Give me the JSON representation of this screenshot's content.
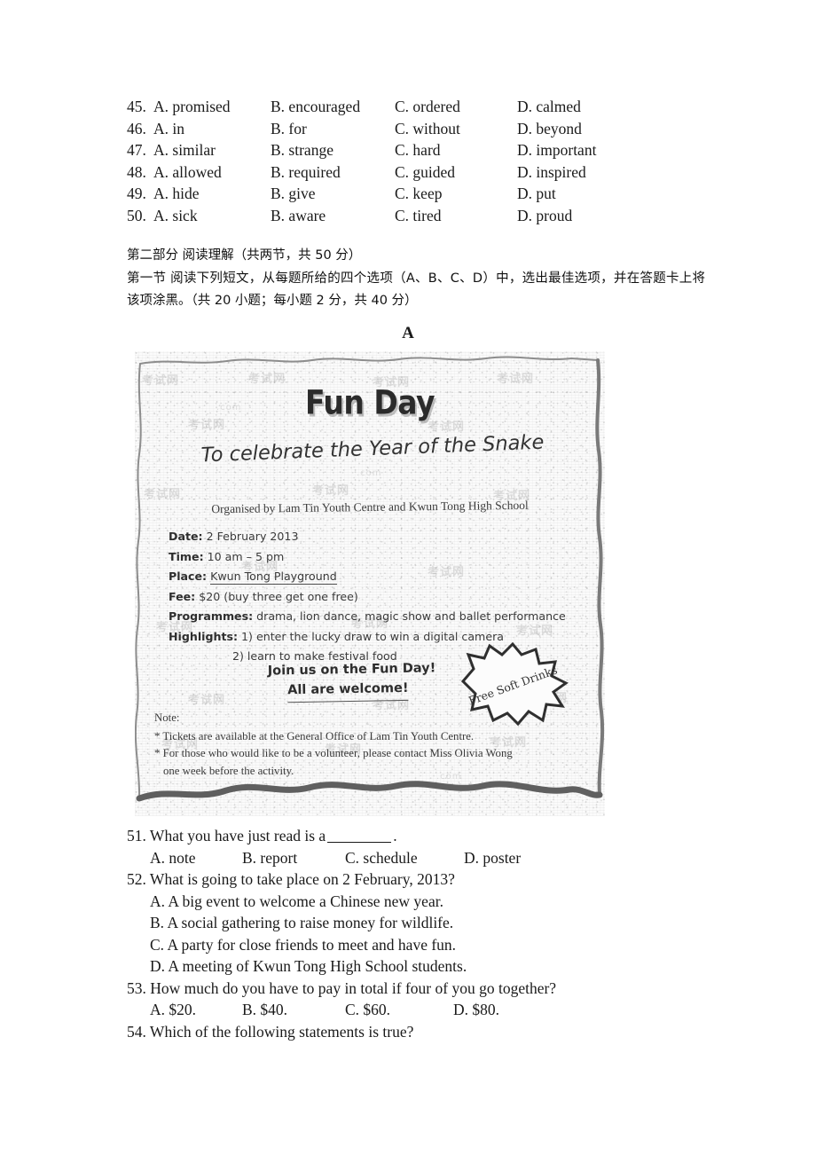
{
  "cloze_options": [
    {
      "num": "45.",
      "a": "A. promised",
      "b": "B. encouraged",
      "c": "C. ordered",
      "d": "D. calmed"
    },
    {
      "num": "46.",
      "a": "A. in",
      "b": "B. for",
      "c": "C. without",
      "d": "D. beyond"
    },
    {
      "num": "47.",
      "a": "A. similar",
      "b": "B. strange",
      "c": "C. hard",
      "d": "D. important"
    },
    {
      "num": "48.",
      "a": "A. allowed",
      "b": "B. required",
      "c": "C. guided",
      "d": "D. inspired"
    },
    {
      "num": "49.",
      "a": "A. hide",
      "b": "B. give",
      "c": "C. keep",
      "d": "D. put"
    },
    {
      "num": "50.",
      "a": "A. sick",
      "b": "B. aware",
      "c": "C. tired",
      "d": "D. proud"
    }
  ],
  "instructions": {
    "part_heading": "第二部分 阅读理解（共两节，共 50 分）",
    "section_text": "第一节 阅读下列短文，从每题所给的四个选项（A、B、C、D）中，选出最佳选项，并在答题卡上将该项涂黑。（共 20 小题；每小题 2 分，共 40 分）"
  },
  "section_letter": "A",
  "poster": {
    "title": "Fun Day",
    "subtitle": "To celebrate the Year of the Snake",
    "organiser": "Organised by Lam Tin Youth Centre and Kwun Tong High School",
    "details": [
      {
        "label": "Date:",
        "value": "2 February 2013"
      },
      {
        "label": "Time:",
        "value": "10 am – 5 pm"
      },
      {
        "label": "Place:",
        "value": "Kwun Tong Playground"
      },
      {
        "label": "Fee:",
        "value": "$20 (buy three get one free)"
      },
      {
        "label": "Programmes:",
        "value": "drama, lion dance, magic show and ballet performance"
      },
      {
        "label": "Highlights:",
        "value": "1) enter the lucky draw to win a digital camera"
      }
    ],
    "highlight_second": "2) learn to make festival food",
    "call_line1": "Join us on the Fun Day!",
    "call_line2": "All are welcome!",
    "badge": "Free Soft Drinks",
    "note_title": "Note:",
    "note_items": [
      "* Tickets are available at the General Office of Lam Tin Youth Centre.",
      "* For those who would like to be a volunteer, please contact Miss Olivia Wong"
    ],
    "note_continuation": "one week before the activity.",
    "watermark_text": "考试网",
    "watermark_text_small": ".com"
  },
  "questions": [
    {
      "stem": "51. What you have just read is a",
      "has_blank": true,
      "stem_tail": ".",
      "layout": "inline",
      "options": [
        "A. note",
        "B. report",
        "C. schedule",
        "D. poster"
      ]
    },
    {
      "stem": "52. What is going to take place on 2 February, 2013?",
      "has_blank": false,
      "layout": "block",
      "options": [
        "A. A big event to welcome a Chinese new year.",
        "B. A social gathering to raise money for wildlife.",
        "C. A party for close friends to meet and have fun.",
        "D. A meeting of Kwun Tong High School students."
      ]
    },
    {
      "stem": "53. How much do you have to pay in total if four of you go together?",
      "has_blank": false,
      "layout": "inline",
      "options": [
        "A. $20.",
        "B. $40.",
        "C. $60.",
        "D. $80."
      ]
    },
    {
      "stem": "54. Which of the following statements is true?",
      "has_blank": false,
      "layout": "none",
      "options": []
    }
  ]
}
